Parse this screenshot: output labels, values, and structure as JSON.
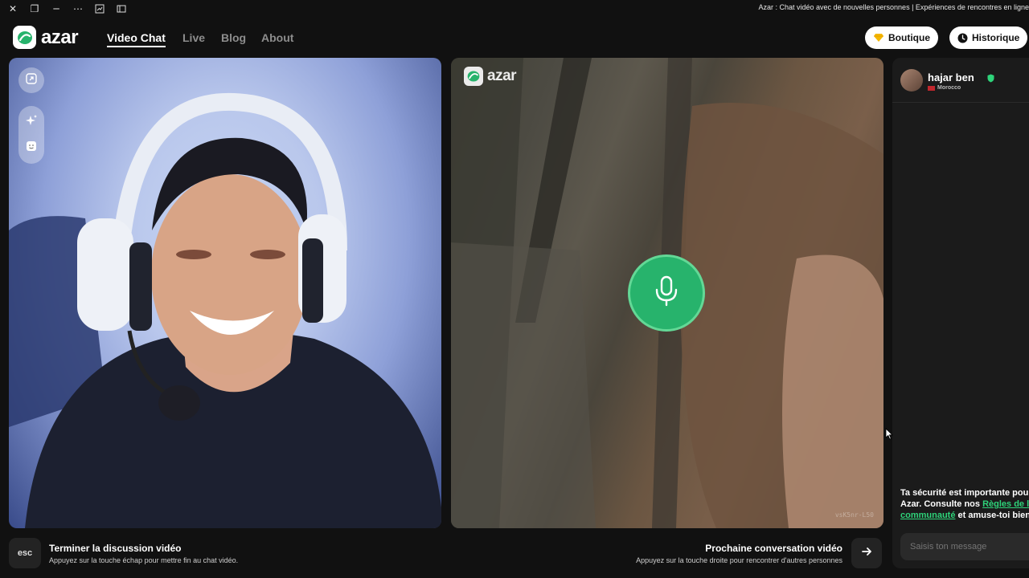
{
  "window": {
    "title": "Azar : Chat vidéo avec de nouvelles personnes | Expériences de rencontres en ligne"
  },
  "brand": {
    "name": "azar",
    "accent": "#27b36c"
  },
  "nav": {
    "links": [
      "Video Chat",
      "Live",
      "Blog",
      "About"
    ],
    "active": "Video Chat",
    "shop_label": "Boutique",
    "history_label": "Historique"
  },
  "left_video": {
    "tools": [
      "expand-icon",
      "sparkle-effects-icon",
      "emoji-mask-icon"
    ]
  },
  "right_video": {
    "watermark": "azar",
    "mic_state": "unmuted",
    "video_code": "vsK5nr-L50"
  },
  "chat": {
    "peer_name": "hajar ben",
    "peer_country": "Morocco",
    "safety_line1": "Ta sécurité est importante pour",
    "safety_line2_prefix": "Azar. Consulte nos ",
    "safety_link_part1": "Règles de la",
    "safety_link_part2": "communauté",
    "safety_line3_suffix": " et amuse-toi bien",
    "input_placeholder": "Saisis ton message"
  },
  "bottom": {
    "esc_key": "esc",
    "end_title": "Terminer la discussion vidéo",
    "end_sub": "Appuyez sur la touche échap pour mettre fin au chat vidéo.",
    "next_title": "Prochaine conversation vidéo",
    "next_sub": "Appuyez sur la touche droite pour rencontrer d'autres personnes"
  }
}
